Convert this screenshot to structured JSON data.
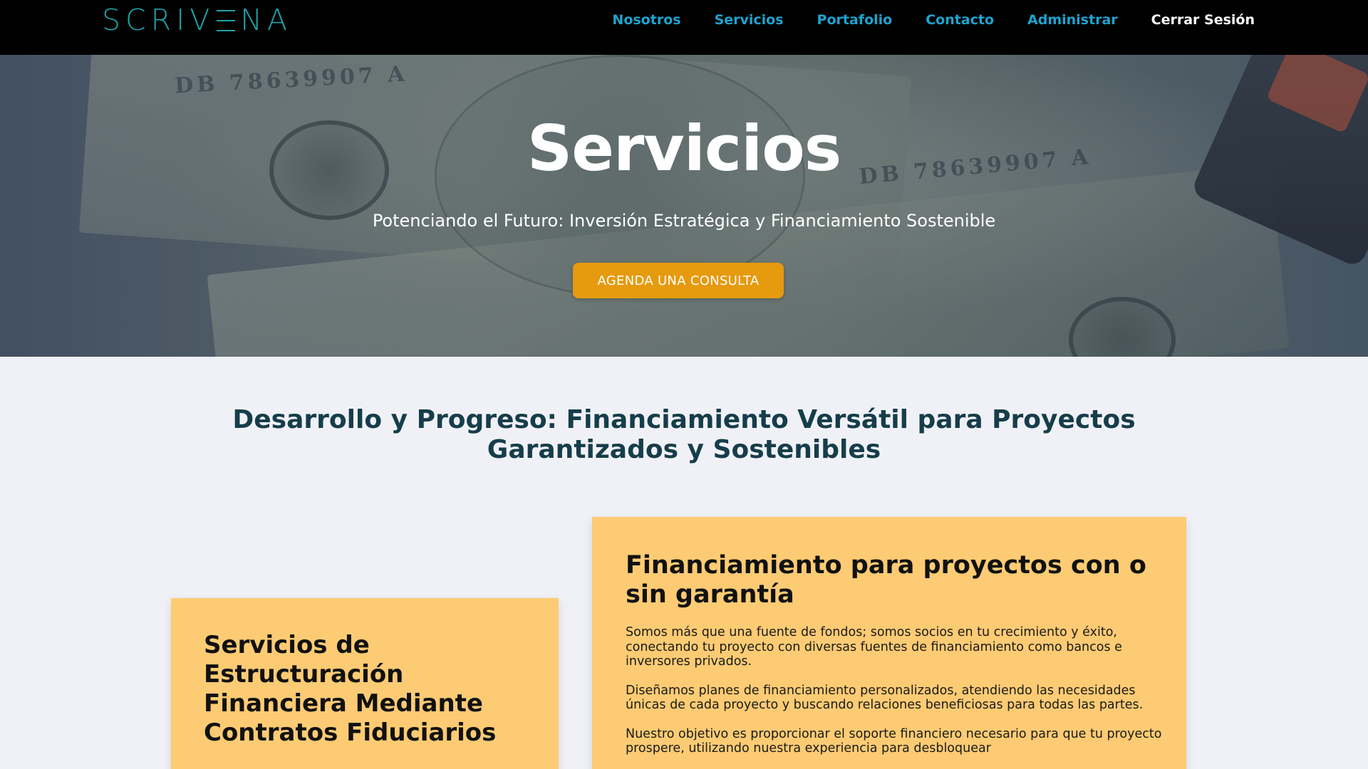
{
  "nav": {
    "logo_text": "SCRIVENA",
    "links": [
      "Nosotros",
      "Servicios",
      "Portafolio",
      "Contacto",
      "Administrar"
    ],
    "logout_label": "Cerrar Sesión"
  },
  "hero": {
    "title": "Servicios",
    "subtitle": "Potenciando el Futuro: Inversión Estratégica y Financiamiento Sostenible",
    "cta_label": "AGENDA UNA CONSULTA"
  },
  "main": {
    "heading_line1": "Desarrollo y Progreso: Financiamiento Versátil para Proyectos",
    "heading_line2": "Garantizados y Sostenibles",
    "card_left": {
      "title": "Servicios de Estructuración Financiera Mediante Contratos Fiduciarios"
    },
    "card_right": {
      "title": "Financiamiento para proyectos con o sin garantía",
      "paragraphs": [
        "Somos más que una fuente de fondos; somos socios en tu crecimiento y éxito, conectando tu proyecto con diversas fuentes de financiamiento como bancos e inversores privados.",
        "Diseñamos planes de financiamiento personalizados, atendiendo las necesidades únicas de cada proyecto y buscando relaciones beneficiosas para todas las partes.",
        "Nuestro objetivo es proporcionar el soporte financiero necesario para que tu proyecto prospere, utilizando nuestra experiencia para desbloquear"
      ]
    }
  },
  "colors": {
    "nav_bg": "#000000",
    "nav_link": "#1fa3cf",
    "logo": "#1fa3a8",
    "cta": "#e69a0e",
    "card": "#fdcb73",
    "heading": "#163d4a",
    "page_bg": "#f0f1f7"
  }
}
